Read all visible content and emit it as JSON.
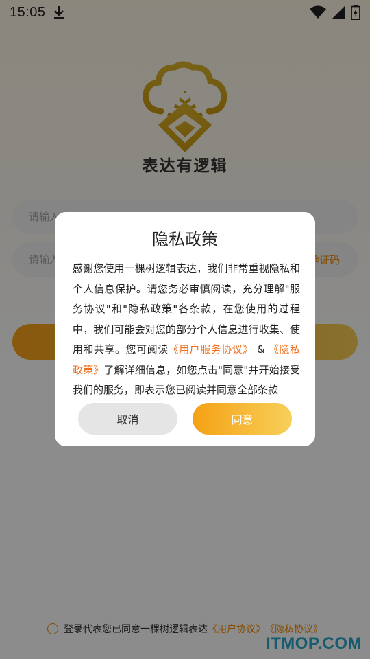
{
  "status_bar": {
    "time": "15:05"
  },
  "app": {
    "name": "表达有逻辑",
    "brand_color": "#f7a21a"
  },
  "login": {
    "phone_placeholder": "请输入",
    "code_placeholder": "请输入",
    "get_code_label": "验证码"
  },
  "agreement": {
    "text": "登录代表您已同意一棵树逻辑表达",
    "user_agreement": "《用户协议》",
    "privacy_agreement": "《隐私协议》"
  },
  "dialog": {
    "title": "隐私政策",
    "body_part1": "感谢您使用一棵树逻辑表达，我们非常重视隐私和个人信息保护。请您务必审慎阅读，充分理解\"服务协议\"和\"隐私政策\"各条款，在您使用的过程中，我们可能会对您的部分个人信息进行收集、使用和共享。您可阅读",
    "link_user_service": "《用户服务协议》",
    "ampersand": " & ",
    "link_privacy": "《隐私政策》",
    "body_part2": "了解详细信息，如您点击\"同意\"并开始接受我们的服务，即表示您已阅读并同意全部条款",
    "cancel_label": "取消",
    "agree_label": "同意"
  },
  "watermark": "ITMOP.COM"
}
